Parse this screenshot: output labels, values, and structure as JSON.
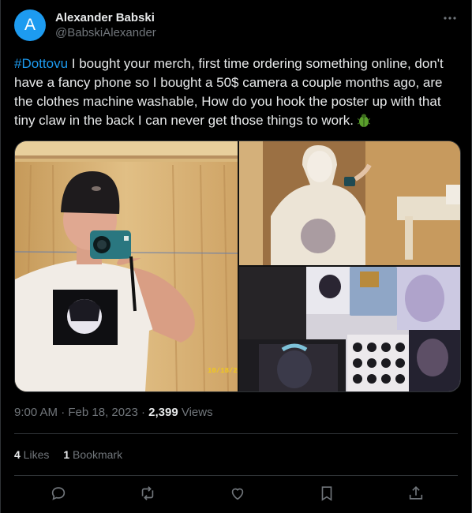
{
  "author": {
    "avatar_letter": "A",
    "display_name": "Alexander Babski",
    "handle": "@BabskiAlexander"
  },
  "tweet": {
    "hashtag": "#Dottovu",
    "text": " I bought your merch, first time ordering something online, don't have a fancy phone so I bought a 50$ camera a couple months ago, are the clothes machine washable, How do you hook the poster up with that tiny claw in the back I can never get those things to work. "
  },
  "media": {
    "photo_date_stamp": "10/18/2"
  },
  "meta": {
    "time": "9:00 AM",
    "sep1": " · ",
    "date": "Feb 18, 2023",
    "sep2": " · ",
    "views_count": "2,399",
    "views_label": " Views"
  },
  "stats": {
    "likes_count": "4",
    "likes_label": " Likes",
    "bookmarks_count": "1",
    "bookmarks_label": " Bookmark"
  },
  "icons": [
    "more-icon",
    "reply-icon",
    "retweet-icon",
    "like-icon",
    "bookmark-icon",
    "share-icon",
    "beetle-emoji"
  ],
  "colors": {
    "accent": "#1d9bf0",
    "text": "#e7e9ea",
    "muted": "#71767b",
    "border": "#2f3336",
    "background": "#000000"
  }
}
